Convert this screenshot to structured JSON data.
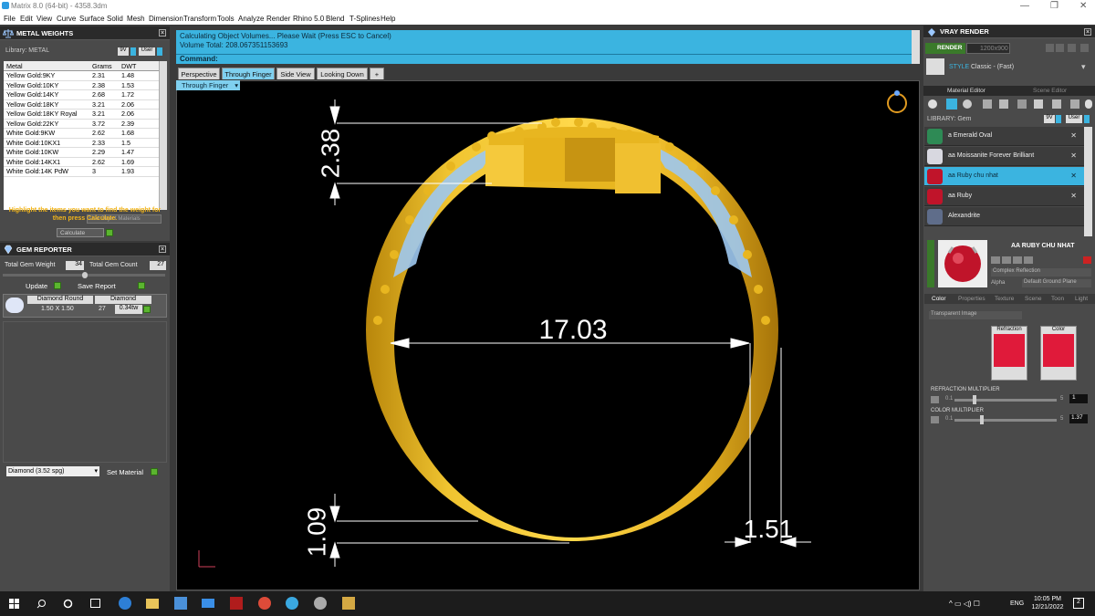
{
  "window": {
    "title": "Matrix 8.0 (64-bit) - 4358.3dm",
    "controls": [
      "—",
      "❐",
      "✕"
    ]
  },
  "menu": [
    "File",
    "Edit",
    "View",
    "Curve",
    "Surface",
    "Solid",
    "Mesh",
    "Dimension",
    "Transform",
    "Tools",
    "Analyze",
    "Render",
    "Rhino 5.0",
    "Blend",
    "T-Splines",
    "Help"
  ],
  "metal_panel": {
    "title": "METAL WEIGHTS",
    "library_label": "Library: METAL",
    "lib_value": "9V",
    "lib_user": "User",
    "columns": [
      "Metal",
      "Grams",
      "DWT"
    ],
    "rows": [
      [
        "Yellow Gold:9KY",
        "2.31",
        "1.48"
      ],
      [
        "Yellow Gold:10KY",
        "2.38",
        "1.53"
      ],
      [
        "Yellow Gold:14KY",
        "2.68",
        "1.72"
      ],
      [
        "Yellow Gold:18KY",
        "3.21",
        "2.06"
      ],
      [
        "Yellow Gold:18KY Royal",
        "3.21",
        "2.06"
      ],
      [
        "Yellow Gold:22KY",
        "3.72",
        "2.39"
      ],
      [
        "White Gold:9KW",
        "2.62",
        "1.68"
      ],
      [
        "White Gold:10KX1",
        "2.33",
        "1.5"
      ],
      [
        "White Gold:10KW",
        "2.29",
        "1.47"
      ],
      [
        "White Gold:14KX1",
        "2.62",
        "1.69"
      ],
      [
        "White Gold:14K PdW",
        "3",
        "1.93"
      ]
    ],
    "use_object_materials": "Use Object Materials",
    "hint": "Highlight the items you want to find the weight for then press Calculate.",
    "calculate": "Calculate"
  },
  "gem_panel": {
    "title": "GEM REPORTER",
    "total_weight_label": "Total Gem Weight",
    "total_weight": "34",
    "total_count_label": "Total Gem Count",
    "total_count": "27",
    "update": "Update",
    "save_report": "Save Report",
    "table_headers": [
      "Diamond Round",
      "Diamond"
    ],
    "gem_row": {
      "size": "1.50 X 1.50",
      "count": "27",
      "weight": "0.34tw"
    },
    "material_select": "Diamond    (3.52 spg)",
    "set_material": "Set Material"
  },
  "command": {
    "line1": "Calculating Object Volumes... Please Wait (Press ESC to Cancel)",
    "line2": "Volume Total: 208.067351153693",
    "prompt": "Command:"
  },
  "tabs": [
    "Perspective",
    "Through Finger",
    "Side View",
    "Looking Down",
    "+"
  ],
  "active_view": "Through Finger",
  "dimensions": {
    "width": "17.03",
    "top": "2.38",
    "bottom": "1.09",
    "side": "1.51"
  },
  "vray": {
    "title": "VRAY RENDER",
    "render": "RENDER",
    "resolution": "1200x900",
    "style_label": "STYLE",
    "style_value": "Classic - (Fast)",
    "tabs": [
      "Material Editor",
      "Scene Editor"
    ],
    "library_label": "LIBRARY: Gem",
    "lib_value": "9V",
    "lib_user": "User",
    "materials": [
      "a Emerald Oval",
      "aa Moissanite Forever Brilliant",
      "aa Ruby chu nhat",
      "aa Ruby",
      "Alexandrite"
    ],
    "selected_material": "AA RUBY CHU NHAT",
    "reflection": "Complex Reflection",
    "alpha": "Alpha",
    "ground": "Default Ground Plane",
    "sub_tabs": [
      "Color",
      "Properties",
      "Texture",
      "Scene",
      "Toon",
      "Light"
    ],
    "transparent": "Transparent Image",
    "refraction_label": "Refraction",
    "color_label": "Color",
    "refraction_multiplier_label": "REFRACTION MULTIPLIER",
    "refraction_min": "0.1",
    "refraction_max": "5",
    "refraction_value": "1",
    "color_multiplier_label": "COLOR MULTIPLIER",
    "color_min": "0.1",
    "color_max": "5",
    "color_value": "1.37",
    "colors": {
      "emerald": "#2e8a55",
      "moissanite": "#d8d8e0",
      "ruby": "#c0142a",
      "alexandrite": "#5f6d8a"
    }
  },
  "taskbar": {
    "time": "10:05 PM",
    "date": "12/21/2022",
    "lang": "ENG",
    "notify": "2"
  },
  "colors": {
    "accent": "#3bb4e0",
    "gold": "#e8b620",
    "gem_blue": "#9dc8f0",
    "panel": "#4a4a4a"
  }
}
